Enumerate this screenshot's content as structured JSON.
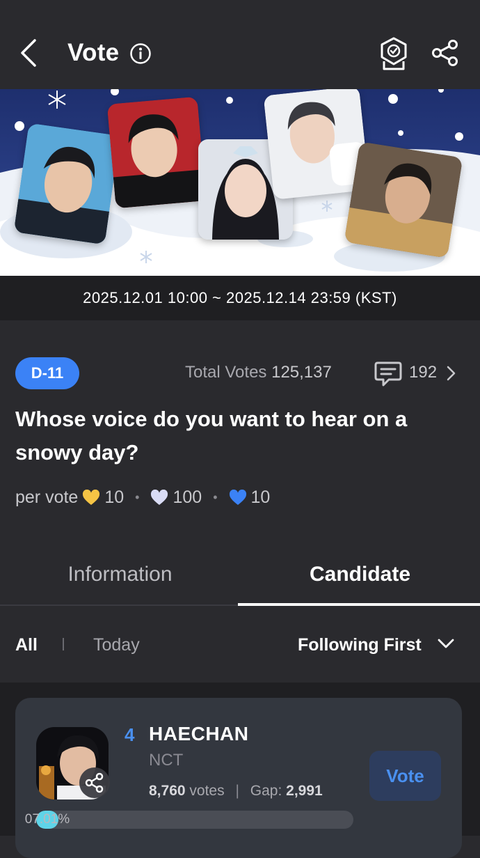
{
  "header": {
    "title": "Vote",
    "icons": [
      "back-arrow-icon",
      "info-icon",
      "award-badge-icon",
      "share-icon"
    ]
  },
  "banner": {
    "photos": [
      "photo-1",
      "photo-2",
      "photo-3",
      "photo-4",
      "photo-5"
    ]
  },
  "period": "2025.12.01 10:00 ~ 2025.12.14 23:59 (KST)",
  "vote": {
    "dday": "D-11",
    "total_label": "Total Votes",
    "total_value": "125,137",
    "comments": "192",
    "question": "Whose voice do you want to hear on a snowy day?",
    "per_vote_label": "per vote",
    "costs": [
      {
        "color": "#f5c445",
        "value": "10"
      },
      {
        "color": "#d9dcf5",
        "value": "100"
      },
      {
        "color": "#3b82f6",
        "value": "10"
      }
    ]
  },
  "tabs": {
    "information": "Information",
    "candidate": "Candidate",
    "active": "Candidate"
  },
  "filters": {
    "all": "All",
    "today": "Today",
    "sort": "Following First"
  },
  "candidates": [
    {
      "rank": "4",
      "name": "HAECHAN",
      "group": "NCT",
      "votes": "8,760",
      "votes_unit": "votes",
      "gap_label": "Gap:",
      "gap": "2,991",
      "percent_label": "07.01%",
      "percent": 7.01,
      "vote_button": "Vote"
    }
  ],
  "colors": {
    "accent": "#3b82f6",
    "progress": "#5fd4e8",
    "background": "#2a2a2e"
  }
}
